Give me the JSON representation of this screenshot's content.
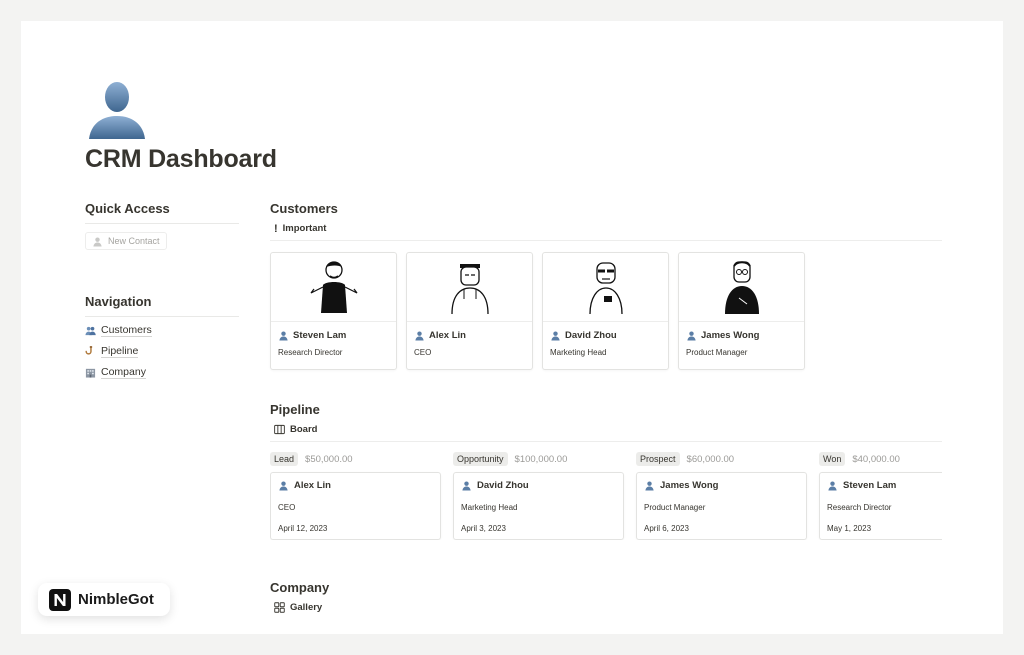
{
  "page": {
    "title": "CRM Dashboard",
    "icon": "person-silhouette-icon"
  },
  "quick_access": {
    "heading": "Quick Access",
    "new_contact": "New Contact"
  },
  "navigation": {
    "heading": "Navigation",
    "items": [
      {
        "label": "Customers",
        "icon": "people-icon"
      },
      {
        "label": "Pipeline",
        "icon": "hook-icon"
      },
      {
        "label": "Company",
        "icon": "building-icon"
      }
    ]
  },
  "customers": {
    "heading": "Customers",
    "view": "Important",
    "cards": [
      {
        "name": "Steven Lam",
        "role": "Research Director"
      },
      {
        "name": "Alex Lin",
        "role": "CEO"
      },
      {
        "name": "David Zhou",
        "role": "Marketing Head"
      },
      {
        "name": "James Wong",
        "role": "Product Manager"
      }
    ]
  },
  "pipeline": {
    "heading": "Pipeline",
    "view": "Board",
    "columns": [
      {
        "stage": "Lead",
        "amount": "$50,000.00",
        "card": {
          "name": "Alex Lin",
          "role": "CEO",
          "date": "April 12, 2023"
        }
      },
      {
        "stage": "Opportunity",
        "amount": "$100,000.00",
        "card": {
          "name": "David Zhou",
          "role": "Marketing Head",
          "date": "April 3, 2023"
        }
      },
      {
        "stage": "Prospect",
        "amount": "$60,000.00",
        "card": {
          "name": "James Wong",
          "role": "Product Manager",
          "date": "April 6, 2023"
        }
      },
      {
        "stage": "Won",
        "amount": "$40,000.00",
        "card": {
          "name": "Steven Lam",
          "role": "Research Director",
          "date": "May 1, 2023"
        }
      }
    ]
  },
  "company": {
    "heading": "Company",
    "view": "Gallery"
  },
  "badge": {
    "brand": "NimbleGot"
  },
  "colors": {
    "person_icon": "#5b7ea6",
    "text": "#37352f",
    "muted": "#9b9a97",
    "tag_bg": "#ececea"
  }
}
